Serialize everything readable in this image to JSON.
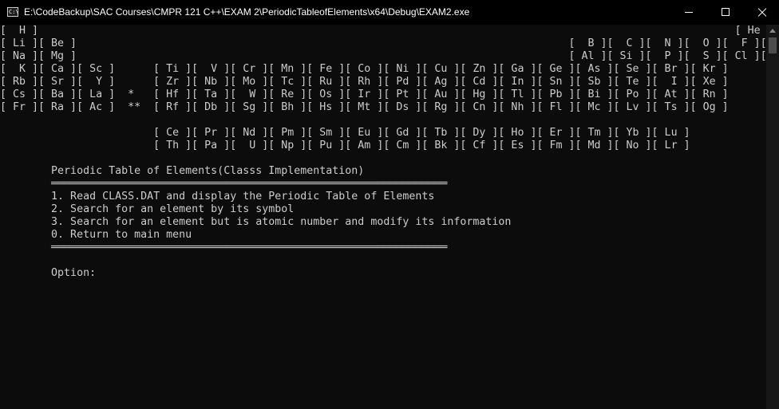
{
  "window": {
    "title": "E:\\CodeBackup\\SAC Courses\\CMPR 121 C++\\EXAM 2\\PeriodicTableofElements\\x64\\Debug\\EXAM2.exe",
    "icon_label": "C:\\"
  },
  "console": {
    "lines": [
      "[  H ]                                                                                                             [ He ]",
      "[ Li ][ Be ]                                                                             [  B ][  C ][  N ][  O ][  F ][ Ne ]",
      "[ Na ][ Mg ]                                                                             [ Al ][ Si ][  P ][  S ][ Cl ][ Ar ]",
      "[  K ][ Ca ][ Sc ]      [ Ti ][  V ][ Cr ][ Mn ][ Fe ][ Co ][ Ni ][ Cu ][ Zn ][ Ga ][ Ge ][ As ][ Se ][ Br ][ Kr ]",
      "[ Rb ][ Sr ][  Y ]      [ Zr ][ Nb ][ Mo ][ Tc ][ Ru ][ Rh ][ Pd ][ Ag ][ Cd ][ In ][ Sn ][ Sb ][ Te ][  I ][ Xe ]",
      "[ Cs ][ Ba ][ La ]  *   [ Hf ][ Ta ][  W ][ Re ][ Os ][ Ir ][ Pt ][ Au ][ Hg ][ Tl ][ Pb ][ Bi ][ Po ][ At ][ Rn ]",
      "[ Fr ][ Ra ][ Ac ]  **  [ Rf ][ Db ][ Sg ][ Bh ][ Hs ][ Mt ][ Ds ][ Rg ][ Cn ][ Nh ][ Fl ][ Mc ][ Lv ][ Ts ][ Og ]",
      "",
      "                        [ Ce ][ Pr ][ Nd ][ Pm ][ Sm ][ Eu ][ Gd ][ Tb ][ Dy ][ Ho ][ Er ][ Tm ][ Yb ][ Lu ]",
      "                        [ Th ][ Pa ][  U ][ Np ][ Pu ][ Am ][ Cm ][ Bk ][ Cf ][ Es ][ Fm ][ Md ][ No ][ Lr ]",
      "",
      "        Periodic Table of Elements(Classs Implementation)",
      "        ══════════════════════════════════════════════════════════════",
      "        1. Read CLASS.DAT and display the Periodic Table of Elements",
      "        2. Search for an element by its symbol",
      "        3. Search for an element but is atomic number and modify its information",
      "        0. Return to main menu",
      "        ══════════════════════════════════════════════════════════════",
      "",
      "        Option: "
    ]
  }
}
